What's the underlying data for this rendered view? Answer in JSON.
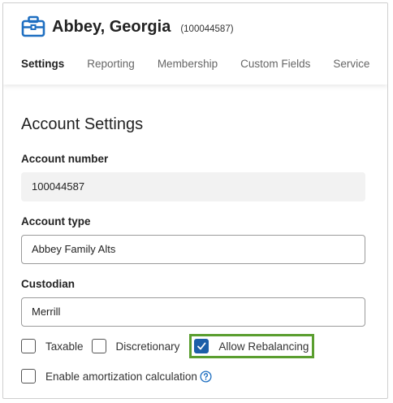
{
  "header": {
    "account_name": "Abbey, Georgia",
    "account_number_display": "(100044587)",
    "icon": "briefcase-icon",
    "icon_color": "#1f6fc1"
  },
  "tabs": [
    {
      "label": "Settings",
      "active": true
    },
    {
      "label": "Reporting",
      "active": false
    },
    {
      "label": "Membership",
      "active": false
    },
    {
      "label": "Custom Fields",
      "active": false
    },
    {
      "label": "Service",
      "active": false
    }
  ],
  "main": {
    "section_title": "Account Settings",
    "account_number": {
      "label": "Account number",
      "value": "100044587"
    },
    "account_type": {
      "label": "Account type",
      "value": "Abbey Family Alts"
    },
    "custodian": {
      "label": "Custodian",
      "value": "Merrill"
    },
    "checkboxes": {
      "taxable": {
        "label": "Taxable",
        "checked": false
      },
      "discretionary": {
        "label": "Discretionary",
        "checked": false
      },
      "allow_rebalancing": {
        "label": "Allow Rebalancing",
        "checked": true
      },
      "amortization": {
        "label": "Enable amortization calculation",
        "checked": false,
        "help_icon": "help-circle-icon"
      }
    },
    "highlight_color": "#5a9e2f",
    "checkbox_checked_color": "#1c5fa8"
  }
}
